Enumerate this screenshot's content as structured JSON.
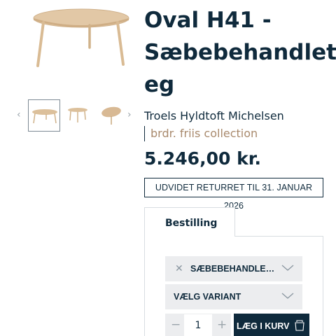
{
  "product": {
    "title_line1": "Oval H41 -",
    "title_line2": "Sæbebehandlet",
    "title_line3": "eg",
    "designer": "Troels Hyldtoft Michelsen",
    "brand": "brdr. friis collection",
    "price": "5.246,00 kr.",
    "return_notice": "UDVIDET RETURRET TIL 31. JANUAR 2026"
  },
  "gallery": {
    "prev_icon": "chevron-left-icon",
    "next_icon": "chevron-right-icon",
    "prev_glyph": "‹",
    "next_glyph": "›",
    "thumbnail_count": 3,
    "active_thumbnail": 1
  },
  "order": {
    "tab_label": "Bestilling",
    "option1_clear_glyph": "✕",
    "option1_value": "SÆBEBEHANDLET EG",
    "option2_placeholder": "VÆLG VARIANT",
    "minus_glyph": "−",
    "plus_glyph": "+",
    "quantity": "1",
    "add_to_cart_label": "LÆG I KURV",
    "cart_icon": "cart-icon"
  },
  "colors": {
    "primary": "#0f2a3c",
    "brand_text": "#a98a6d",
    "wood": "#dcc09b",
    "select_bg": "#ecedef"
  }
}
